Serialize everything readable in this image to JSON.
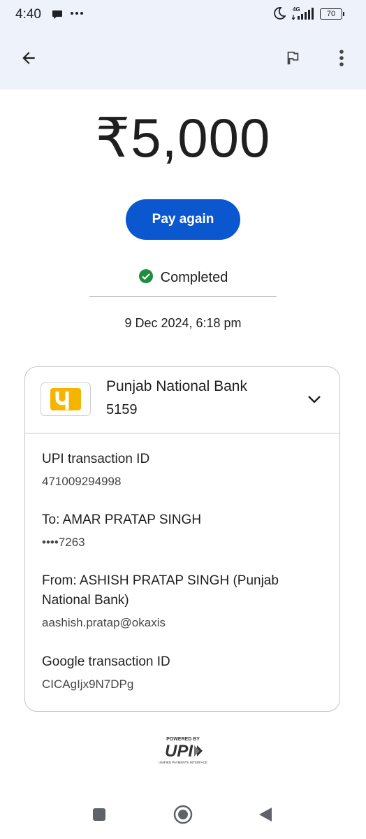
{
  "status_bar": {
    "time": "4:40",
    "network": "4G",
    "battery": "70",
    "icons": [
      "chat-bubble-icon",
      "more-dots-icon",
      "moon-icon",
      "signal-icon",
      "battery-icon"
    ]
  },
  "app_bar": {
    "icons": [
      "back-arrow-icon",
      "flag-icon",
      "more-vert-icon"
    ]
  },
  "payment": {
    "amount": "₹5,000",
    "pay_again_label": "Pay again",
    "status": "Completed",
    "datetime": "9 Dec 2024, 6:18 pm"
  },
  "bank": {
    "name": "Punjab National Bank",
    "account": "5159"
  },
  "details": [
    {
      "label": "UPI transaction ID",
      "value": "471009294998"
    },
    {
      "label": "To: AMAR PRATAP SINGH",
      "value": "••••7263"
    },
    {
      "label": "From: ASHISH PRATAP SINGH (Punjab National Bank)",
      "value": "aashish.pratap@okaxis"
    },
    {
      "label": "Google transaction ID",
      "value": "CICAgIjx9N7DPg"
    }
  ],
  "footer": {
    "powered_by": "POWERED BY",
    "upi_brand": "UPI",
    "upi_tagline": "UNIFIED PAYMENTS INTERFACE"
  },
  "colors": {
    "header_bg": "#eef2fb",
    "primary": "#0b57d0",
    "success": "#1e8e3e",
    "pnb_yellow": "#f5b400"
  }
}
